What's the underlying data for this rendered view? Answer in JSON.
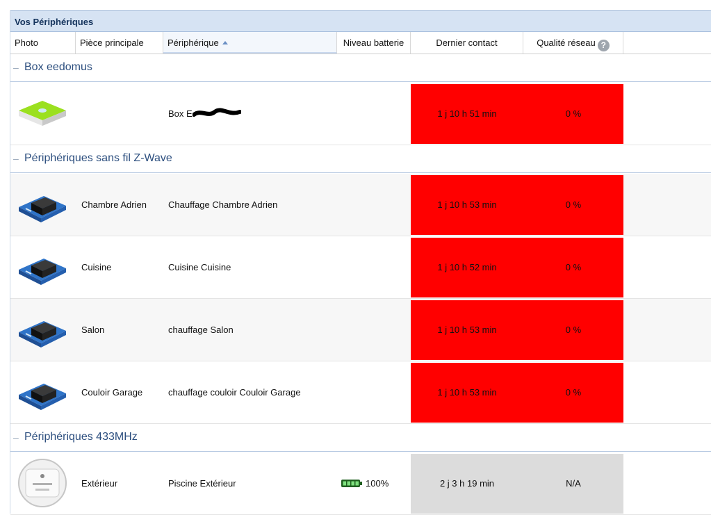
{
  "panel": {
    "title": "Vos Périphériques"
  },
  "columns": {
    "photo": "Photo",
    "room": "Pièce principale",
    "device": "Périphérique",
    "battery": "Niveau batterie",
    "last_contact": "Dernier contact",
    "network_quality": "Qualité réseau",
    "help_glyph": "?"
  },
  "groups": [
    {
      "label": "Box eedomus",
      "rows": [
        {
          "room": "",
          "device": "Box E",
          "battery": "",
          "last_contact": "1 j 10 h 51 min",
          "quality": "0 %",
          "photo_icon": "eedomus-box-icon"
        }
      ]
    },
    {
      "label": "Périphériques sans fil Z-Wave",
      "rows": [
        {
          "room": "Chambre Adrien",
          "device": "Chauffage Chambre Adrien",
          "battery": "",
          "last_contact": "1 j 10 h 53 min",
          "quality": "0 %",
          "photo_icon": "zwave-module-icon"
        },
        {
          "room": "Cuisine",
          "device": "Cuisine Cuisine",
          "battery": "",
          "last_contact": "1 j 10 h 52 min",
          "quality": "0 %",
          "photo_icon": "zwave-module-icon"
        },
        {
          "room": "Salon",
          "device": "chauffage Salon",
          "battery": "",
          "last_contact": "1 j 10 h 53 min",
          "quality": "0 %",
          "photo_icon": "zwave-module-icon"
        },
        {
          "room": "Couloir Garage",
          "device": "chauffage couloir Couloir Garage",
          "battery": "",
          "last_contact": "1 j 10 h 53 min",
          "quality": "0 %",
          "photo_icon": "zwave-module-icon"
        }
      ]
    },
    {
      "label": "Périphériques 433MHz",
      "rows": [
        {
          "room": "Extérieur",
          "device": "Piscine Extérieur",
          "battery": "100%",
          "last_contact": "2 j 3 h 19 min",
          "quality": "N/A",
          "photo_icon": "rf433-module-icon"
        }
      ]
    }
  ],
  "colors": {
    "alert": "#ff0000",
    "neutral": "#dcdcdc",
    "title_bg": "#d6e3f3",
    "group_text": "#2d4f7f"
  }
}
